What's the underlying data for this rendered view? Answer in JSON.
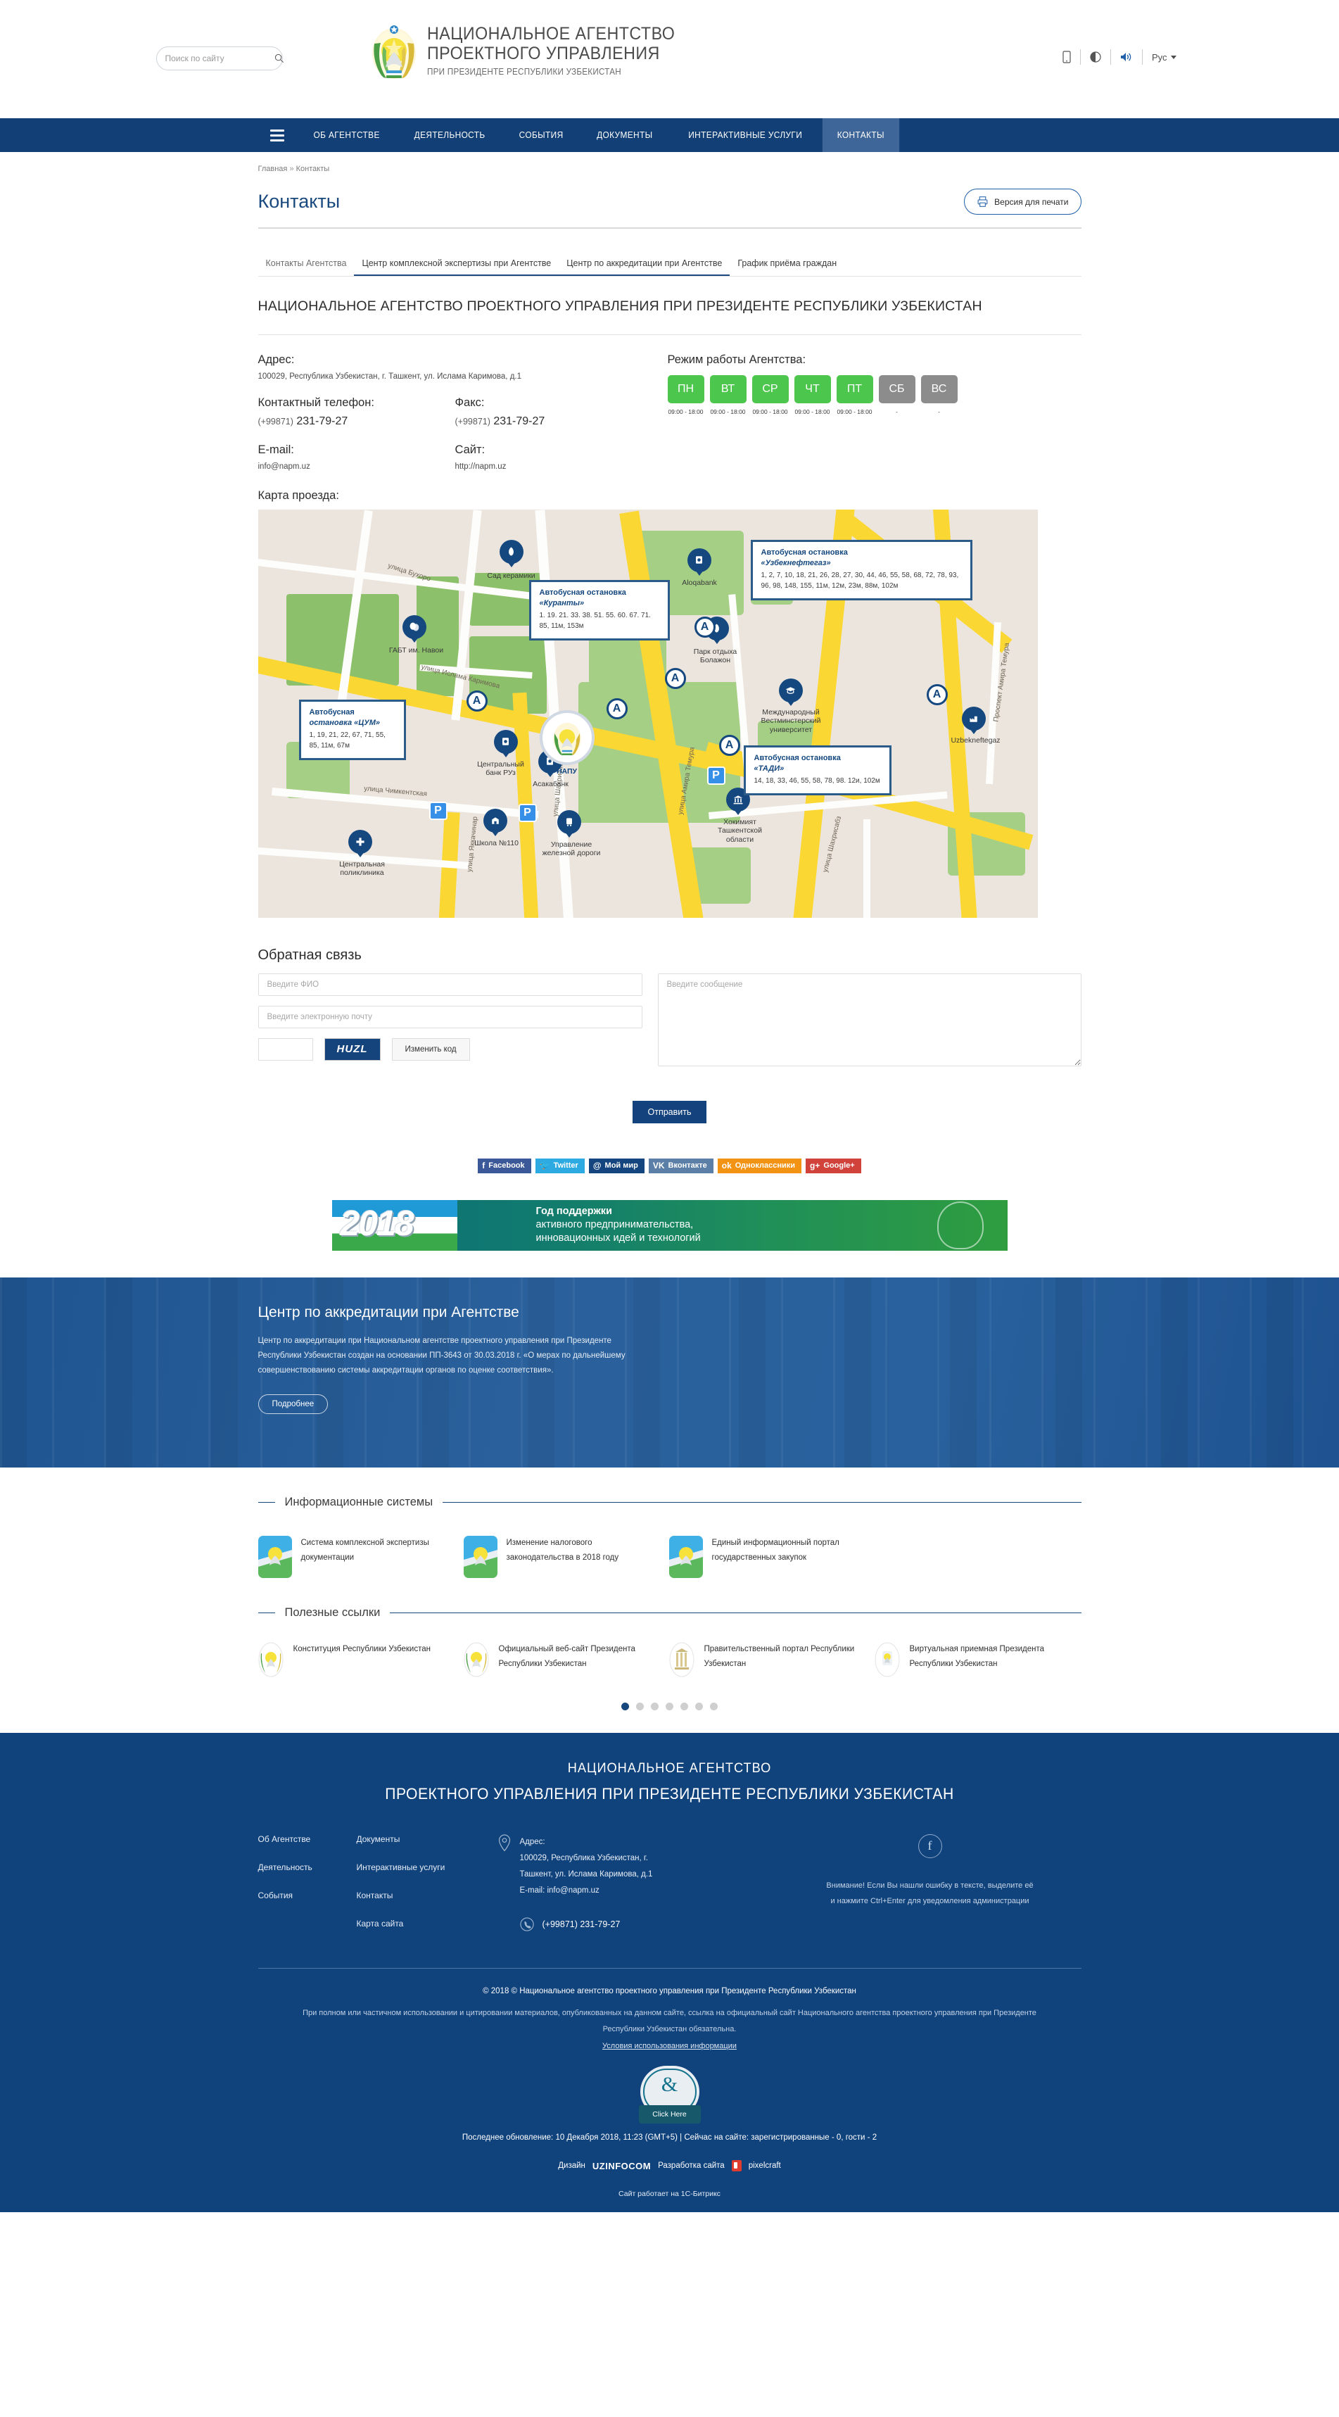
{
  "header": {
    "search_placeholder": "Поиск по сайту",
    "search_value": "",
    "brand_line1": "НАЦИОНАЛЬНОЕ АГЕНТСТВО",
    "brand_line2": "ПРОЕКТНОГО УПРАВЛЕНИЯ",
    "brand_line3": "ПРИ ПРЕЗИДЕНТЕ РЕСПУБЛИКИ УЗБЕКИСТАН",
    "tools": [
      "mobile-version-icon",
      "visually-impaired-icon",
      "audio-icon"
    ],
    "language": "Рус"
  },
  "nav": {
    "menu_icon": "burger-menu-icon",
    "items": [
      {
        "label": "ОБ АГЕНТСТВЕ",
        "active": false
      },
      {
        "label": "ДЕЯТЕЛЬНОСТЬ",
        "active": false
      },
      {
        "label": "СОБЫТИЯ",
        "active": false
      },
      {
        "label": "ДОКУМЕНТЫ",
        "active": false
      },
      {
        "label": "ИНТЕРАКТИВНЫЕ УСЛУГИ",
        "active": false
      },
      {
        "label": "КОНТАКТЫ",
        "active": true
      }
    ]
  },
  "breadcrumb": {
    "home": "Главная",
    "sep": "»",
    "current": "Контакты"
  },
  "page": {
    "title": "Контакты",
    "print_label": "Версия для печати",
    "print_icon": "printer-icon"
  },
  "tabs": [
    {
      "label": "Контакты Агентства",
      "active": true
    },
    {
      "label": "Центр комплексной экспертизы при Агентстве",
      "active": false
    },
    {
      "label": "Центр по аккредитации при Агентстве",
      "active": false
    },
    {
      "label": "График приёма граждан",
      "active": false
    }
  ],
  "content": {
    "heading": "НАЦИОНАЛЬНОЕ АГЕНТСТВО ПРОЕКТНОГО УПРАВЛЕНИЯ ПРИ ПРЕЗИДЕНТЕ РЕСПУБЛИКИ УЗБЕКИСТАН",
    "address_label": "Адрес:",
    "address_value": "100029, Республика Узбекистан, г. Ташкент, ул. Ислама Каримова, д.1",
    "phone_label": "Контактный телефон:",
    "phone_cc": "(+99871)",
    "phone_value": "231-79-27",
    "fax_label": "Факс:",
    "fax_cc": "(+99871)",
    "fax_value": "231-79-27",
    "email_label": "E-mail:",
    "email_value": "info@napm.uz",
    "site_label": "Сайт:",
    "site_value": "http://napm.uz",
    "schedule_title": "Режим работы Агентства:",
    "schedule": [
      {
        "day": "ПН",
        "time": "09:00 - 18:00",
        "open": true
      },
      {
        "day": "ВТ",
        "time": "09:00 - 18:00",
        "open": true
      },
      {
        "day": "СР",
        "time": "09:00 - 18:00",
        "open": true
      },
      {
        "day": "ЧТ",
        "time": "09:00 - 18:00",
        "open": true
      },
      {
        "day": "ПТ",
        "time": "09:00 - 18:00",
        "open": true
      },
      {
        "day": "СБ",
        "time": "-",
        "open": false
      },
      {
        "day": "ВС",
        "time": "-",
        "open": false
      }
    ],
    "map_title": "Карта проезда:"
  },
  "map": {
    "streets": [
      "улица Бухоро",
      "улица Ислама Каримова",
      "улица Чимкентская",
      "улица Шахрисабз",
      "улица Яккачинар",
      "улица Шаxриcабз",
      "Проспект Амира Темура",
      "улица Амира Темура"
    ],
    "places": [
      {
        "name": "Сад керамики",
        "icon": "park-icon"
      },
      {
        "name": "Aloqabank",
        "icon": "bank-icon"
      },
      {
        "name": "ГАБТ им. Навои",
        "icon": "theatre-icon"
      },
      {
        "name": "Центральный банк РУз",
        "icon": "bank-icon"
      },
      {
        "name": "Асакабанк",
        "icon": "bank-icon"
      },
      {
        "name": "Парк отдыха Болажон",
        "icon": "park-icon"
      },
      {
        "name": "Международный Вестминстерский университет",
        "icon": "university-icon"
      },
      {
        "name": "Uzbekneftegaz",
        "icon": "factory-icon"
      },
      {
        "name": "Хокимият Ташкентской области",
        "icon": "government-icon"
      },
      {
        "name": "Школа №110",
        "icon": "school-icon"
      },
      {
        "name": "Управление железной дороги",
        "icon": "railway-icon"
      },
      {
        "name": "Центральная поликлиника",
        "icon": "clinic-icon"
      },
      {
        "name": "НАПУ",
        "icon": "napm-marker"
      }
    ],
    "bus_stops": [
      {
        "title": "Автобусная остановка",
        "name": "«Узбекнефтегаз»",
        "routes": "1, 2, 7, 10, 18, 21, 26, 28, 27, 30, 44, 46, 55, 58, 68, 72, 78, 93, 96, 98, 148, 155, 11м, 12м, 23м, 88м, 102м"
      },
      {
        "title": "Автобусная остановка",
        "name": "«Куранты»",
        "routes": "1. 19. 21. 33. 38. 51. 55. 60. 67. 71. 85, 11м, 153м"
      },
      {
        "title": "Автобусная",
        "name": "остановка «ЦУМ»",
        "routes": "1, 19, 21, 22, 67, 71, 55, 85, 11м, 67м"
      },
      {
        "title": "Автобусная остановка",
        "name": "«ТАДИ»",
        "routes": "14, 18, 33, 46, 55, 58, 78, 98. 12и, 102м"
      }
    ]
  },
  "feedback": {
    "title": "Обратная связь",
    "name_placeholder": "Введите ФИО",
    "name_value": "",
    "email_placeholder": "Введите электронную почту",
    "email_value": "",
    "message_placeholder": "Введите сообщение",
    "message_value": "",
    "captcha_value": "",
    "captcha_text": "HUZL",
    "change_code_label": "Изменить код",
    "submit_label": "Отправить"
  },
  "social": [
    {
      "label": "Facebook",
      "glyph": "f",
      "color": "#3b5998"
    },
    {
      "label": "Twitter",
      "glyph": "🐦",
      "color": "#2daae1"
    },
    {
      "label": "Мой мир",
      "glyph": "@",
      "color": "#14457e"
    },
    {
      "label": "Вконтакте",
      "glyph": "VK",
      "color": "#5b7fa6"
    },
    {
      "label": "Одноклассники",
      "glyph": "ok",
      "color": "#f39313"
    },
    {
      "label": "Google+",
      "glyph": "g+",
      "color": "#d0423a"
    }
  ],
  "banner": {
    "year": "2018",
    "line1": "Год поддержки",
    "line2": "активного предпринимательства,",
    "line3": "инновационных идей и технологий"
  },
  "accreditation": {
    "title": "Центр по аккредитации при Агентстве",
    "text": "Центр по аккредитации при Национальном агентстве проектного управления при Президенте Республики Узбекистан создан на основании ПП-3643 от 30.03.2018 г. «О мерах по дальнейшему совершенствованию системы аккредитации органов по оценке соответствия».",
    "more_label": "Подробнее"
  },
  "info_systems": {
    "title": "Информационные системы",
    "items": [
      {
        "label": "Система комплексной экспертизы документации",
        "icon": "uzbekistan-emblem-icon"
      },
      {
        "label": "Изменение налогового законодательства в 2018 году",
        "icon": "uzbekistan-emblem-icon"
      },
      {
        "label": "Единый информационный портал государственных закупок",
        "icon": "uzbekistan-emblem-icon"
      }
    ]
  },
  "useful_links": {
    "title": "Полезные ссылки",
    "items": [
      {
        "label": "Конституция Республики Узбекистан",
        "icon": "uzbekistan-emblem-icon"
      },
      {
        "label": "Официальный веб-сайт Президента Республики Узбекистан",
        "icon": "uzbekistan-emblem-icon"
      },
      {
        "label": "Правительственный портал Республики Узбекистан",
        "icon": "government-building-icon"
      },
      {
        "label": "Виртуальная приемная Президента Республики Узбекистан",
        "icon": "uzbekistan-emblem-icon"
      }
    ],
    "dots": 7,
    "active_dot": 0
  },
  "footer": {
    "title_line1": "НАЦИОНАЛЬНОЕ АГЕНТСТВО",
    "title_line2": "ПРОЕКТНОГО УПРАВЛЕНИЯ ПРИ ПРЕЗИДЕНТЕ РЕСПУБЛИКИ УЗБЕКИСТАН",
    "nav_col1": [
      "Об Агентстве",
      "Деятельность",
      "События"
    ],
    "nav_col2": [
      "Документы",
      "Интерактивные услуги",
      "Контакты",
      "Карта сайта"
    ],
    "address_icon": "location-pin-icon",
    "address_label": "Адрес:",
    "address_line1": "100029, Республика Узбекистан, г.",
    "address_line2": "Ташкент, ул. Ислама Каримова, д.1",
    "address_email": "E-mail: info@napm.uz",
    "phone_icon": "phone-icon",
    "phone": "(+99871) 231-79-27",
    "facebook_icon": "facebook-icon",
    "notice": "Внимание! Если Вы нашли ошибку в тексте, выделите её и нажмите Ctrl+Enter для уведомления администрации",
    "copyright": "© 2018 © Национальное агентство проектного управления при Президенте Республики Узбекистан",
    "legal": "При полном или частичном использовании и цитировании материалов, опубликованных на данном сайте, ссылка на официальный сайт Национального агентства проектного управления при Президенте Республики Узбекистан обязательна.",
    "terms": "Условия использования информации",
    "dnb_seal": "DUN & BRADSTREET",
    "dnb_button": "Click Here",
    "last_update": "Последнее обновление: 10 Декабря 2018, 11:23 (GMT+5) | Сейчас на сайте: зарегистрированные - 0, гости - 2",
    "design_label": "Дизайн",
    "design_brand": "UZINFOCOM",
    "dev_label": "Разработка сайта",
    "dev_brand": "pixelcraft",
    "bitrix": "Сайт работает на 1С-Битрикс"
  }
}
